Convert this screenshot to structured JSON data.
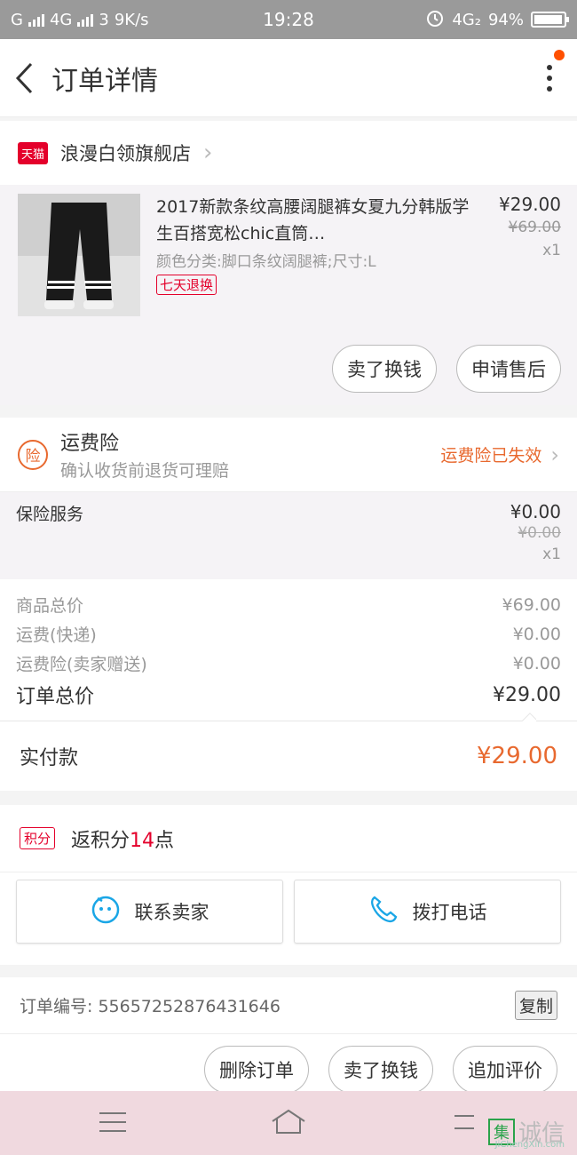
{
  "status_bar": {
    "carrier": "G",
    "network1": "4G",
    "network2": "3",
    "speed": "9K/s",
    "time": "19:28",
    "network3": "4G₂",
    "battery": "94%"
  },
  "header": {
    "title": "订单详情"
  },
  "shop": {
    "badge": "天猫",
    "name": "浪漫白领旗舰店"
  },
  "product": {
    "title": "2017新款条纹高腰阔腿裤女夏九分韩版学生百搭宽松chic直筒…",
    "spec": "颜色分类:脚口条纹阔腿裤;尺寸:L",
    "tag": "七天退换",
    "price": "¥29.00",
    "original_price": "¥69.00",
    "quantity": "x1",
    "btn_sell": "卖了换钱",
    "btn_after_sale": "申请售后"
  },
  "insurance": {
    "icon_text": "险",
    "title": "运费险",
    "subtitle": "确认收货前退货可理赔",
    "status": "运费险已失效"
  },
  "service": {
    "label": "保险服务",
    "price": "¥0.00",
    "original_price": "¥0.00",
    "quantity": "x1"
  },
  "totals": {
    "goods_label": "商品总价",
    "goods_value": "¥69.00",
    "shipping_label": "运费(快递)",
    "shipping_value": "¥0.00",
    "insurance_label": "运费险(卖家赠送)",
    "insurance_value": "¥0.00",
    "order_label": "订单总价",
    "order_value": "¥29.00"
  },
  "paid": {
    "label": "实付款",
    "value": "¥29.00"
  },
  "points": {
    "badge": "积分",
    "text_prefix": "返积分",
    "count": "14",
    "text_suffix": "点"
  },
  "contact": {
    "seller": "联系卖家",
    "call": "拨打电话"
  },
  "order": {
    "number_label": "订单编号: 55657252876431646",
    "copy": "复制"
  },
  "actions": {
    "delete": "删除订单",
    "sell": "卖了换钱",
    "review": "追加评价"
  },
  "watermark": {
    "box": "集",
    "text": "诚信",
    "sub": "JiChengXin.com"
  },
  "colors": {
    "accent": "#e8692f",
    "tmall_red": "#e4002b",
    "badge_dot": "#ff5000"
  }
}
